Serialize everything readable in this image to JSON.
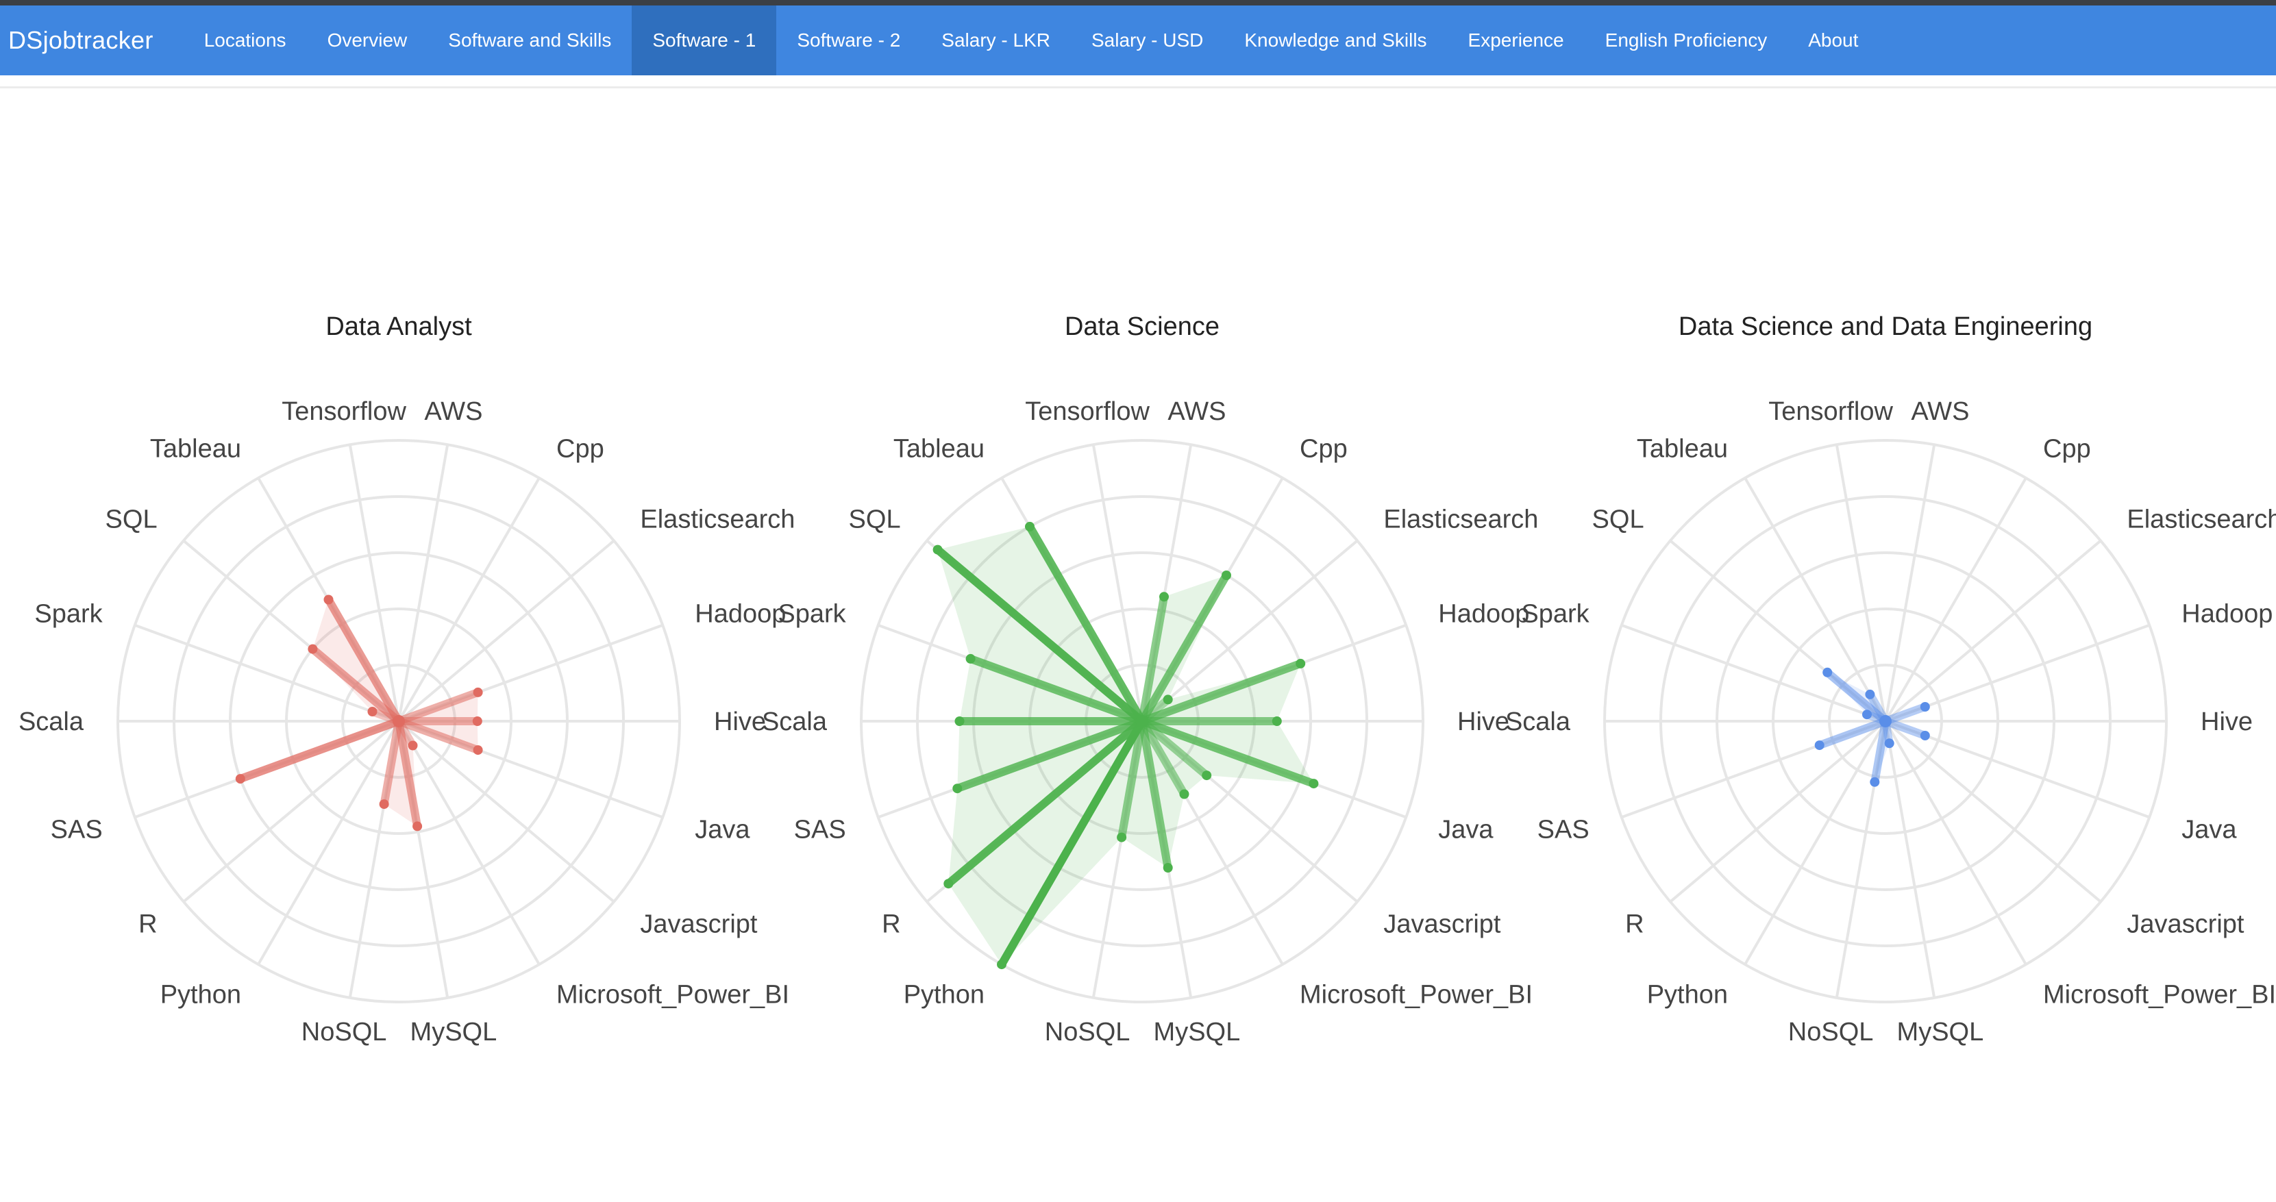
{
  "navbar": {
    "brand": "DSjobtracker",
    "items": [
      {
        "label": "Locations",
        "active": false
      },
      {
        "label": "Overview",
        "active": false
      },
      {
        "label": "Software and Skills",
        "active": false
      },
      {
        "label": "Software - 1",
        "active": true
      },
      {
        "label": "Software - 2",
        "active": false
      },
      {
        "label": "Salary - LKR",
        "active": false
      },
      {
        "label": "Salary - USD",
        "active": false
      },
      {
        "label": "Knowledge and Skills",
        "active": false
      },
      {
        "label": "Experience",
        "active": false
      },
      {
        "label": "English Proficiency",
        "active": false
      },
      {
        "label": "About",
        "active": false
      }
    ]
  },
  "chart_data": [
    {
      "type": "radar",
      "title": "Data Analyst",
      "color": "#e06b61",
      "categories": [
        "AWS",
        "Cpp",
        "Elasticsearch",
        "Hadoop",
        "Hive",
        "Java",
        "Javascript",
        "Microsoft_Power_BI",
        "MySQL",
        "NoSQL",
        "Python",
        "R",
        "SAS",
        "Scala",
        "Spark",
        "SQL",
        "Tableau",
        "Tensorflow"
      ],
      "values": [
        0,
        0,
        0,
        30,
        28,
        30,
        0,
        10,
        38,
        30,
        0,
        0,
        60,
        0,
        10,
        40,
        50,
        0
      ],
      "rmax": 100,
      "grid": true
    },
    {
      "type": "radar",
      "title": "Data Science",
      "color": "#4cb24c",
      "categories": [
        "AWS",
        "Cpp",
        "Elasticsearch",
        "Hadoop",
        "Hive",
        "Java",
        "Javascript",
        "Microsoft_Power_BI",
        "MySQL",
        "NoSQL",
        "Python",
        "R",
        "SAS",
        "Scala",
        "Spark",
        "SQL",
        "Tableau",
        "Tensorflow"
      ],
      "values": [
        45,
        60,
        12,
        60,
        48,
        65,
        30,
        30,
        53,
        42,
        100,
        90,
        70,
        65,
        65,
        95,
        80,
        0
      ],
      "rmax": 100,
      "grid": true
    },
    {
      "type": "radar",
      "title": "Data Science and Data Engineering",
      "color": "#5a8ee8",
      "categories": [
        "AWS",
        "Cpp",
        "Elasticsearch",
        "Hadoop",
        "Hive",
        "Java",
        "Javascript",
        "Microsoft_Power_BI",
        "MySQL",
        "NoSQL",
        "Python",
        "R",
        "SAS",
        "Scala",
        "Spark",
        "SQL",
        "Tableau",
        "Tensorflow"
      ],
      "values": [
        0,
        0,
        0,
        15,
        0,
        15,
        0,
        0,
        8,
        22,
        0,
        0,
        25,
        0,
        7,
        27,
        11,
        0
      ],
      "rmax": 100,
      "grid": true
    }
  ]
}
